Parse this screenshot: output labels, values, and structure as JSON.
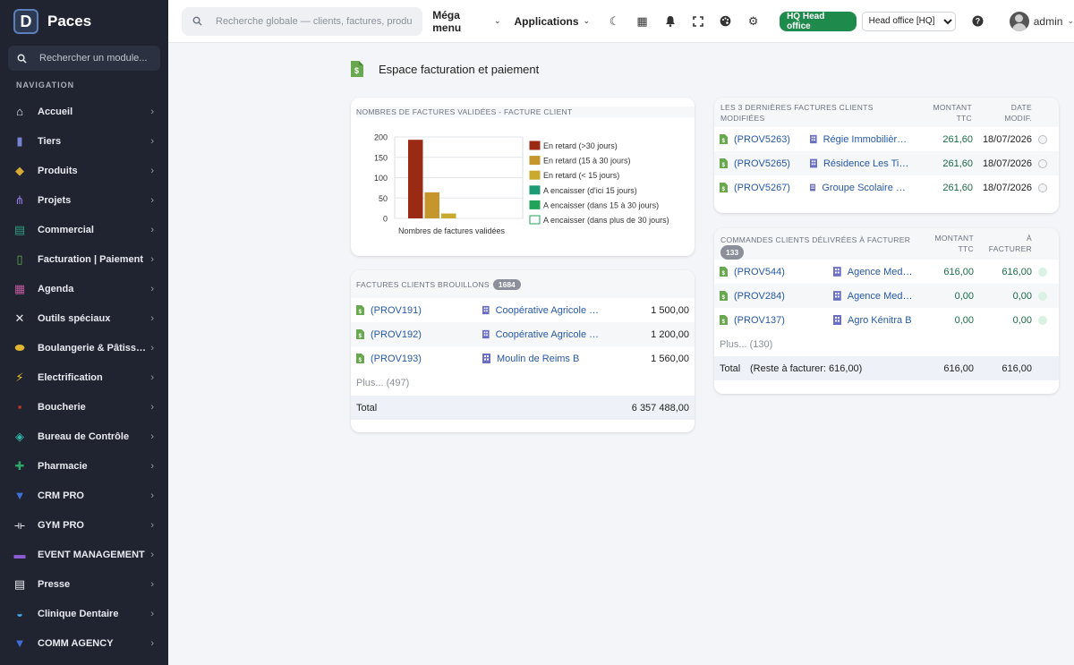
{
  "brand": {
    "name": "Paces",
    "logo_letter": "D"
  },
  "sidebar": {
    "search_placeholder": "Rechercher un module...",
    "nav_title": "NAVIGATION",
    "items": [
      {
        "label": "Accueil",
        "icon": "home-icon",
        "glyph": "⌂",
        "color": "#e8eaf0"
      },
      {
        "label": "Tiers",
        "icon": "building-icon",
        "glyph": "▮",
        "color": "#7b83d6"
      },
      {
        "label": "Produits",
        "icon": "box-icon",
        "glyph": "◆",
        "color": "#d6a935"
      },
      {
        "label": "Projets",
        "icon": "sitemap-icon",
        "glyph": "⋔",
        "color": "#8e7be0"
      },
      {
        "label": "Commercial",
        "icon": "suitcase-icon",
        "glyph": "▤",
        "color": "#2e9e7f"
      },
      {
        "label": "Facturation | Paiement",
        "icon": "invoice-icon",
        "glyph": "▯",
        "color": "#6aa84f"
      },
      {
        "label": "Agenda",
        "icon": "calendar-icon",
        "glyph": "▦",
        "color": "#c0579a"
      },
      {
        "label": "Outils spéciaux",
        "icon": "tools-icon",
        "glyph": "✕",
        "color": "#e8eaf0"
      },
      {
        "label": "Boulangerie & Pâtisserie",
        "icon": "bread-icon",
        "glyph": "⬬",
        "color": "#e0b532"
      },
      {
        "label": "Electrification",
        "icon": "bolt-icon",
        "glyph": "⚡",
        "color": "#f2c21b"
      },
      {
        "label": "Boucherie",
        "icon": "meat-icon",
        "glyph": "▪",
        "color": "#c0392b"
      },
      {
        "label": "Bureau de Contrôle",
        "icon": "shield-icon",
        "glyph": "◈",
        "color": "#2fb5a8"
      },
      {
        "label": "Pharmacie",
        "icon": "cross-icon",
        "glyph": "✚",
        "color": "#2ea868"
      },
      {
        "label": "CRM PRO",
        "icon": "funnel-icon",
        "glyph": "▼",
        "color": "#3f6fd6"
      },
      {
        "label": "GYM PRO",
        "icon": "dumbbell-icon",
        "glyph": "⟛",
        "color": "#e8eaf0"
      },
      {
        "label": "EVENT MANAGEMENT",
        "icon": "ticket-icon",
        "glyph": "▬",
        "color": "#8e5bd6"
      },
      {
        "label": "Presse",
        "icon": "newspaper-icon",
        "glyph": "▤",
        "color": "#e8eaf0"
      },
      {
        "label": "Clinique Dentaire",
        "icon": "tooth-icon",
        "glyph": "◒",
        "color": "#3fa9e0"
      },
      {
        "label": "COMM AGENCY",
        "icon": "megaphone-icon",
        "glyph": "▼",
        "color": "#3f6fd6"
      }
    ]
  },
  "topbar": {
    "search_placeholder": "Recherche globale — clients, factures, produits...",
    "mega_menu": "Méga menu",
    "applications": "Applications",
    "hq_badge": "HQ Head office",
    "entity_selected": "Head office [HQ]",
    "user": "admin"
  },
  "page": {
    "title": "Espace facturation et paiement"
  },
  "chart_card": {
    "title": "NOMBRES DE FACTURES VALIDÉES - FACTURE CLIENT",
    "chart_data": {
      "type": "bar",
      "xlabel": "Nombres de factures validées",
      "ylim": [
        0,
        200
      ],
      "yticks": [
        0,
        50,
        100,
        150,
        200
      ],
      "series": [
        {
          "name": "En retard (>30 jours)",
          "value": 193,
          "color": "#9b2a14"
        },
        {
          "name": "En retard (15 à 30 jours)",
          "value": 64,
          "color": "#c4962c"
        },
        {
          "name": "En retard (< 15 jours)",
          "value": 12,
          "color": "#c9a92e"
        },
        {
          "name": "A encaisser (d'ici 15 jours)",
          "value": 0,
          "color": "#1d9b74"
        },
        {
          "name": "A encaisser (dans 15 à 30 jours)",
          "value": 0,
          "color": "#21a35a"
        },
        {
          "name": "A encaisser (dans plus de 30 jours)",
          "value": 0,
          "color": "#ffffff"
        }
      ]
    }
  },
  "drafts_card": {
    "title": "FACTURES CLIENTS BROUILLONS",
    "count": "1684",
    "rows": [
      {
        "ref": "(PROV191)",
        "client": "Coopérative Agricole Toubkal",
        "amount": "1 500,00"
      },
      {
        "ref": "(PROV192)",
        "client": "Coopérative Agricole Toubkal",
        "amount": "1 200,00"
      },
      {
        "ref": "(PROV193)",
        "client": "Moulin de Reims B",
        "amount": "1 560,00"
      }
    ],
    "more": "Plus... (497)",
    "total_label": "Total",
    "total_amount": "6 357 488,00"
  },
  "last_invoices_card": {
    "title": "LES 3 DERNIÈRES FACTURES CLIENTS MODIFIÉES",
    "col_amount": "MONTANT TTC",
    "col_date": "DATE MODIF.",
    "rows": [
      {
        "ref": "(PROV5263)",
        "client": "Régie Immobilière Atlas",
        "amount": "261,60",
        "date": "18/07/2026"
      },
      {
        "ref": "(PROV5265)",
        "client": "Résidence Les Tilleuls",
        "amount": "261,60",
        "date": "18/07/2026"
      },
      {
        "ref": "(PROV5267)",
        "client": "Groupe Scolaire Jules Verne",
        "amount": "261,60",
        "date": "18/07/2026"
      }
    ]
  },
  "orders_card": {
    "title": "COMMANDES CLIENTS DÉLIVRÉES À FACTURER",
    "count": "133",
    "col_amount": "MONTANT TTC",
    "col_tobill": "À FACTURER",
    "rows": [
      {
        "ref": "(PROV544)",
        "client": "Agence Medina",
        "amount": "616,00",
        "tobill": "616,00"
      },
      {
        "ref": "(PROV284)",
        "client": "Agence Medina",
        "amount": "0,00",
        "tobill": "0,00"
      },
      {
        "ref": "(PROV137)",
        "client": "Agro Kénitra B",
        "amount": "0,00",
        "tobill": "0,00"
      }
    ],
    "more": "Plus... (130)",
    "total_label": "Total",
    "total_note": "(Reste à facturer: 616,00)",
    "total_amount": "616,00",
    "total_tobill": "616,00"
  }
}
